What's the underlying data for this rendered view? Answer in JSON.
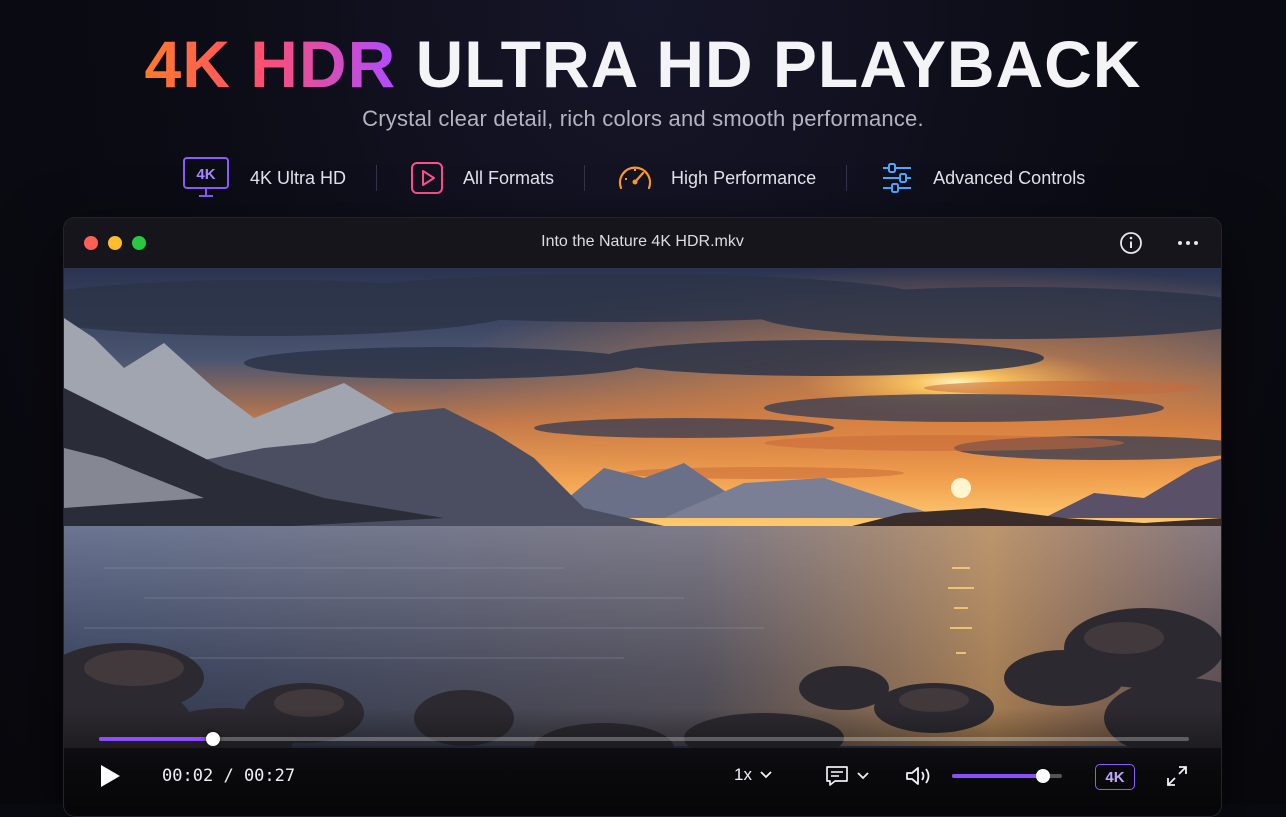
{
  "hero": {
    "title_accent": "4K HDR",
    "title_rest": "ULTRA HD PLAYBACK",
    "subtitle": "Crystal clear detail, rich colors and smooth performance."
  },
  "features": [
    {
      "icon": "4k-monitor-icon",
      "badge": "4K",
      "label": "4K Ultra HD",
      "color": "#8a5cff"
    },
    {
      "icon": "play-square-icon",
      "label": "All Formats",
      "color": "#ff4f8a"
    },
    {
      "icon": "speedometer-icon",
      "label": "High Performance",
      "color": "#ff9a2a"
    },
    {
      "icon": "sliders-icon",
      "label": "Advanced Controls",
      "color": "#4aa8ff"
    }
  ],
  "window": {
    "title": "Into the Nature 4K HDR.mkv",
    "traffic_lights": [
      "#ff5f57",
      "#febc2e",
      "#28c840"
    ]
  },
  "player": {
    "current_time": "00:02",
    "separator": "/",
    "total_time": "00:27",
    "progress_fraction": 0.105,
    "speed": "1x",
    "volume_fraction": 0.83,
    "quality_badge": "4K",
    "accent": "#8a4dff"
  }
}
